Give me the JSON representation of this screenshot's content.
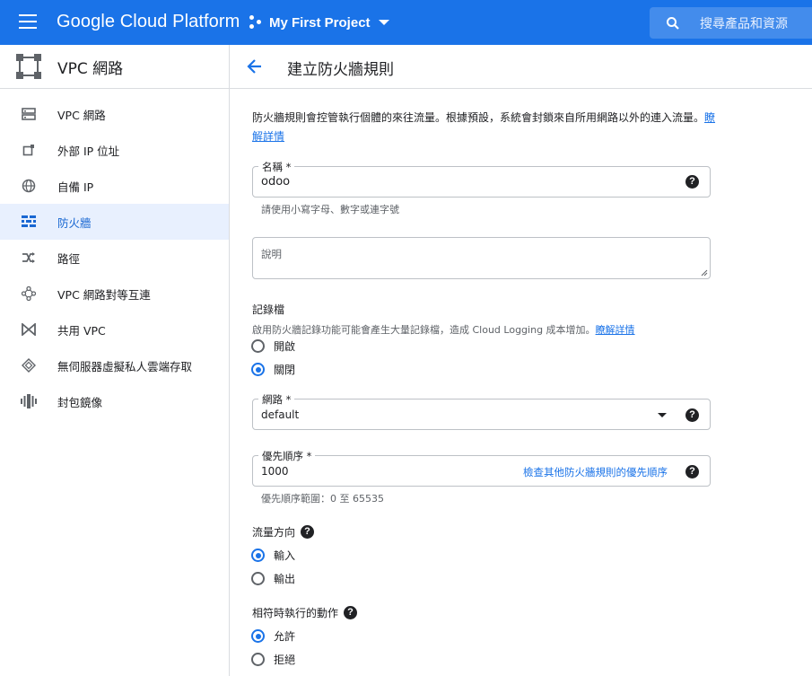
{
  "topbar": {
    "product_name": "Google Cloud Platform",
    "project_name": "My First Project",
    "search_placeholder": "搜尋產品和資源"
  },
  "sidebar": {
    "title": "VPC 網路",
    "items": [
      {
        "label": "VPC 網路",
        "icon": "vpc-network-icon",
        "active": false
      },
      {
        "label": "外部 IP 位址",
        "icon": "external-ip-icon",
        "active": false
      },
      {
        "label": "自備 IP",
        "icon": "globe-icon",
        "active": false
      },
      {
        "label": "防火牆",
        "icon": "firewall-icon",
        "active": true
      },
      {
        "label": "路徑",
        "icon": "routes-icon",
        "active": false
      },
      {
        "label": "VPC 網路對等互連",
        "icon": "peering-icon",
        "active": false
      },
      {
        "label": "共用 VPC",
        "icon": "shared-vpc-icon",
        "active": false
      },
      {
        "label": "無伺服器虛擬私人雲端存取",
        "icon": "serverless-access-icon",
        "active": false
      },
      {
        "label": "封包鏡像",
        "icon": "packet-mirroring-icon",
        "active": false
      }
    ]
  },
  "header": {
    "page_title": "建立防火牆規則"
  },
  "form": {
    "intro_text": "防火牆規則會控管執行個體的來往流量。根據預設，系統會封鎖來自所用網路以外的連入流量。",
    "intro_link": "瞭解詳情",
    "name": {
      "label": "名稱 *",
      "value": "odoo",
      "hint": "請使用小寫字母、數字或連字號"
    },
    "description": {
      "placeholder": "說明"
    },
    "logs": {
      "title": "記錄檔",
      "desc": "啟用防火牆記錄功能可能會產生大量記錄檔，造成 Cloud Logging 成本增加。",
      "link": "瞭解詳情",
      "options": [
        {
          "label": "開啟",
          "checked": false
        },
        {
          "label": "關閉",
          "checked": true
        }
      ]
    },
    "network": {
      "label": "網路 *",
      "value": "default"
    },
    "priority": {
      "label": "優先順序 *",
      "value": "1000",
      "link": "檢查其他防火牆規則的優先順序",
      "hint": "優先順序範圍：0 至 65535"
    },
    "direction": {
      "title": "流量方向",
      "options": [
        {
          "label": "輸入",
          "checked": true
        },
        {
          "label": "輸出",
          "checked": false
        }
      ]
    },
    "action": {
      "title": "相符時執行的動作",
      "options": [
        {
          "label": "允許",
          "checked": true
        },
        {
          "label": "拒絕",
          "checked": false
        }
      ]
    }
  },
  "colors": {
    "brand_blue": "#1a73e8",
    "active_bg": "#e8f0fe",
    "text": "#202124",
    "muted": "#5f6368",
    "border": "#dadce0"
  }
}
